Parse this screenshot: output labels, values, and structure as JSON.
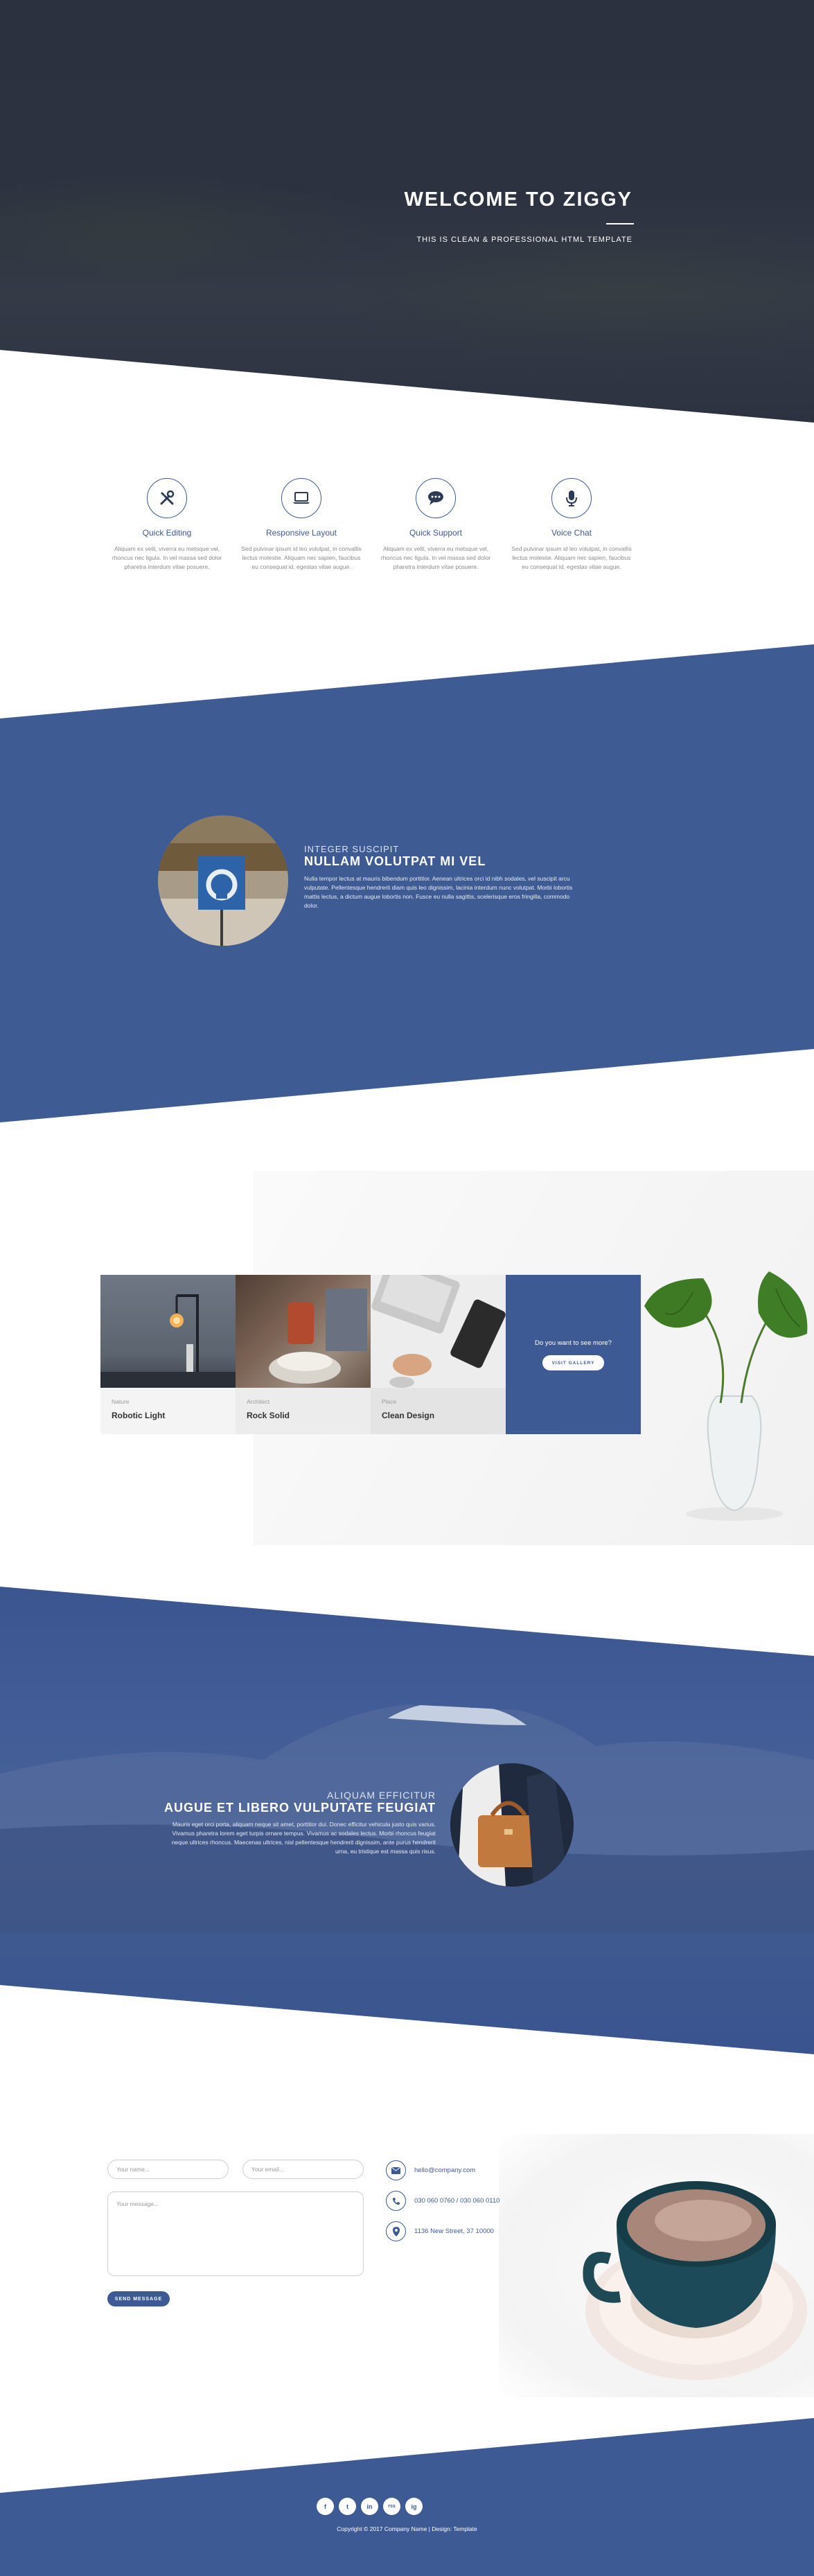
{
  "hero": {
    "title": "WELCOME TO ZIGGY",
    "subtitle": "THIS IS CLEAN & PROFESSIONAL HTML TEMPLATE"
  },
  "features": [
    {
      "title": "Quick Editing",
      "icon": "tools-icon",
      "text": "Aliquam ex velit, viverra eu metsque vel, rhoncus nec ligula. In vel massa sed dolor pharetra interdum vitae posuere."
    },
    {
      "title": "Responsive Layout",
      "icon": "laptop-icon",
      "text": "Sed pulvinar ipsum id leo volutpat, in convallis lectus molestie. Aliquam nec sapien, faucibus eu consequat id, egestas vitae augue."
    },
    {
      "title": "Quick Support",
      "icon": "chat-icon",
      "text": "Aliquam ex velit, viverra eu metsque vel, rhoncus nec ligula. In vel massa sed dolor pharetra interdum vitae posuere."
    },
    {
      "title": "Voice Chat",
      "icon": "microphone-icon",
      "text": "Sed pulvinar ipsum id leo volutpat, in convallis lectus molestie. Aliquam nec sapien, faucibus eu consequat id, egestas vitae augue."
    }
  ],
  "about": {
    "kicker": "INTEGER SUSCIPIT",
    "title": "NULLAM VOLUTPAT MI VEL",
    "text": "Nulla tempor lectus at mauris bibendum porttitor. Aenean ultrices orci id nibh sodales, vel suscipit arcu vulputate. Pellentesque hendrerit diam quis leo dignissim, lacinia interdum nunc volutpat. Morbi lobortis mattis lectus, a dictum augue lobortis non. Fusce eu nulla sagittis, scelerisque eros fringilla, commodo dolor."
  },
  "gallery": {
    "cards": [
      {
        "meta": "Nature",
        "name": "Robotic Light"
      },
      {
        "meta": "Architect",
        "name": "Rock Solid"
      },
      {
        "meta": "Place",
        "name": "Clean Design"
      }
    ],
    "cta_text": "Do you want to see more?",
    "cta_button": "VISIT GALLERY"
  },
  "feature2": {
    "kicker": "ALIQUAM EFFICITUR",
    "title": "AUGUE ET LIBERO VULPUTATE FEUGIAT",
    "text": "Mauris eget orci porta, aliquam neque sit amet, porttitor dui. Donec efficitur vehicula justo quis varius. Vivamus pharetra lorem eget turpis ornare tempus. Vivamus ac sodales lectus. Morbi rhoncus feugiat neque ultrices rhoncus. Maecenas ultrices, nisl pellentesque hendrerit dignissim, ante purus hendrerit urna, eu tristique est massa quis risus."
  },
  "contact": {
    "name_placeholder": "Your name...",
    "email_placeholder": "Your email...",
    "message_placeholder": "Your message...",
    "send_label": "SEND MESSAGE",
    "email": "hello@company.com",
    "phone": "030 060 0760 / 030 060 0110",
    "address": "1136 New Street, 37 10000"
  },
  "footer": {
    "social": [
      "f",
      "t",
      "in",
      "rss",
      "ig"
    ],
    "copyright": "Copyright © 2017 Company Name | Design: Template"
  },
  "colors": {
    "brand_blue": "#3e5a94",
    "hero_dark": "#2c3240"
  }
}
